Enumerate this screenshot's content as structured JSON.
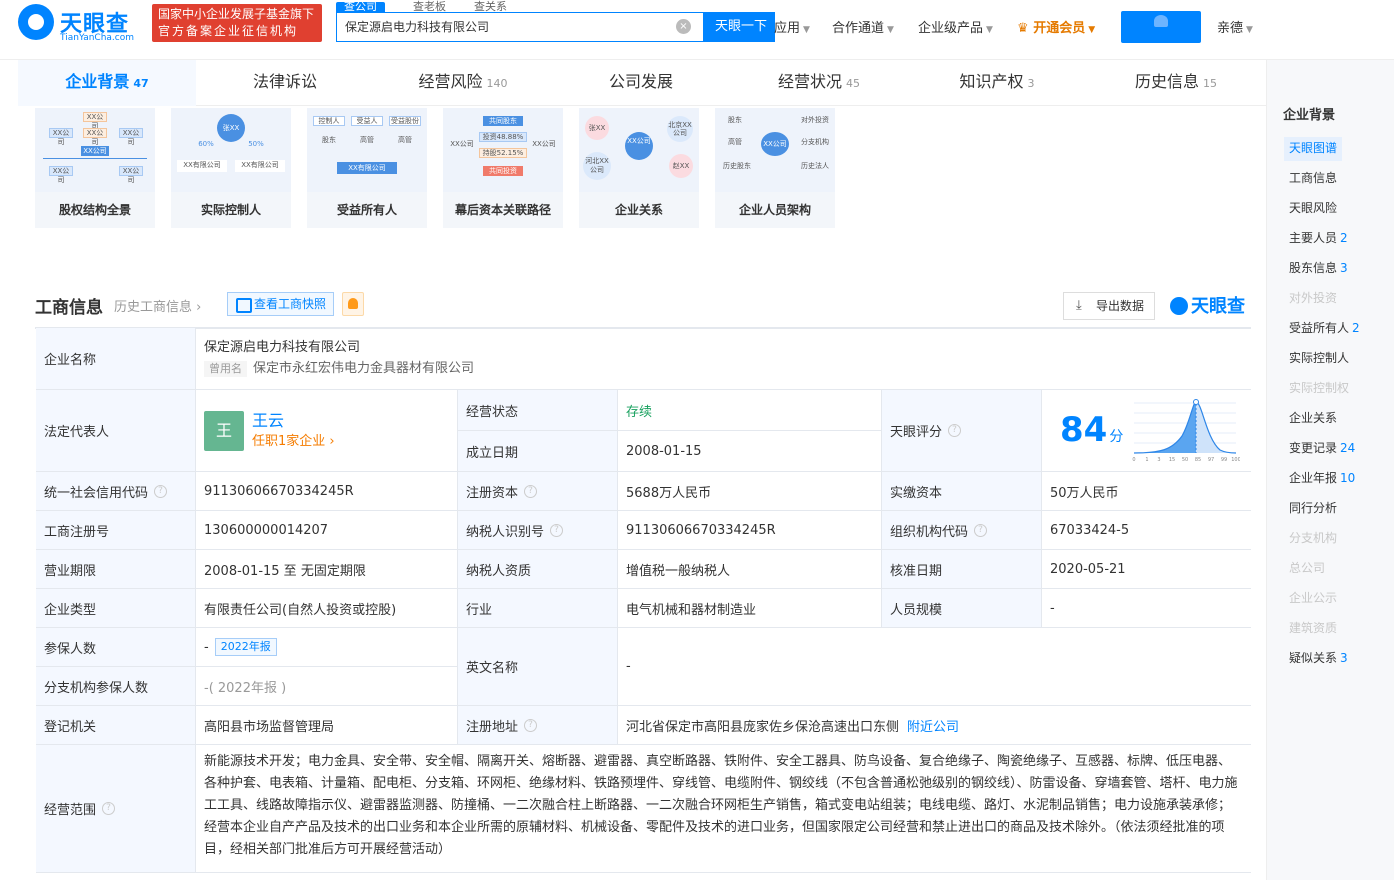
{
  "header": {
    "logo_text": "天眼查",
    "logo_sub": "TianYanCha.com",
    "gov_badge_line1": "国家中小企业发展子基金旗下",
    "gov_badge_line2": "官方备案企业征信机构",
    "search_tabs": [
      "查公司",
      "查老板",
      "查关系"
    ],
    "search_value": "保定源启电力科技有限公司",
    "search_button": "天眼一下",
    "nav_apps": "应用",
    "nav_channel": "合作通道",
    "nav_enterprise": "企业级产品",
    "nav_vip": "开通会员",
    "nav_user": "亲德"
  },
  "tabs": [
    {
      "label": "企业背景",
      "count": "47"
    },
    {
      "label": "法律诉讼",
      "count": ""
    },
    {
      "label": "经营风险",
      "count": "140"
    },
    {
      "label": "公司发展",
      "count": ""
    },
    {
      "label": "经营状况",
      "count": "45"
    },
    {
      "label": "知识产权",
      "count": "3"
    },
    {
      "label": "历史信息",
      "count": "15"
    }
  ],
  "cards": [
    {
      "title": "股权结构全景",
      "texts": [
        "XX公司",
        "XX公司",
        "XX公司",
        "XX公司",
        "XX公司",
        "XX公司",
        "XX公司"
      ]
    },
    {
      "title": "实际控制人",
      "texts": [
        "张XX",
        "XX有限公司",
        "XX有限公司",
        "60%",
        "50%"
      ]
    },
    {
      "title": "受益所有人",
      "texts": [
        "控制人",
        "受益人",
        "受益股份",
        "股东",
        "高管",
        "高管",
        "XX有限公司"
      ]
    },
    {
      "title": "幕后资本关联路径",
      "texts": [
        "共同股东",
        "XX公司",
        "XX公司",
        "投资48.88%",
        "持股52.15%",
        "共同投资"
      ]
    },
    {
      "title": "企业关系",
      "texts": [
        "张XX",
        "北京XX公司",
        "XX公司",
        "河北XX公司",
        "赵XX"
      ]
    },
    {
      "title": "企业人员架构",
      "texts": [
        "股东",
        "对外投资",
        "高管",
        "XX公司",
        "分支机构",
        "历史股东",
        "历史法人"
      ]
    }
  ],
  "section": {
    "title": "工商信息",
    "history_link": "历史工商信息",
    "snapshot_button": "查看工商快照",
    "export_button": "导出数据",
    "watermark": "天眼查"
  },
  "info": {
    "company_name_label": "企业名称",
    "company_name": "保定源启电力科技有限公司",
    "former_name_tag": "曾用名",
    "former_name": "保定市永红宏伟电力金具器材有限公司",
    "legal_rep_label": "法定代表人",
    "legal_rep_avatar": "王",
    "legal_rep_name": "王云",
    "legal_rep_sub": "任职1家企业",
    "status_label": "经营状态",
    "status": "存续",
    "founded_label": "成立日期",
    "founded": "2008-01-15",
    "score_label": "天眼评分",
    "score": "84",
    "score_unit": "分",
    "score_ticks": [
      "0",
      "1",
      "3",
      "15",
      "50",
      "85",
      "97",
      "99",
      "100"
    ],
    "credit_code_label": "统一社会信用代码",
    "credit_code": "91130606670334245R",
    "reg_capital_label": "注册资本",
    "reg_capital": "5688万人民币",
    "paid_capital_label": "实缴资本",
    "paid_capital": "50万人民币",
    "reg_no_label": "工商注册号",
    "reg_no": "130600000014207",
    "taxpayer_id_label": "纳税人识别号",
    "taxpayer_id": "91130606670334245R",
    "org_code_label": "组织机构代码",
    "org_code": "67033424-5",
    "term_label": "营业期限",
    "term": "2008-01-15 至 无固定期限",
    "taxpayer_type_label": "纳税人资质",
    "taxpayer_type": "增值税一般纳税人",
    "approval_label": "核准日期",
    "approval": "2020-05-21",
    "type_label": "企业类型",
    "type": "有限责任公司(自然人投资或控股)",
    "industry_label": "行业",
    "industry": "电气机械和器材制造业",
    "staff_label": "人员规模",
    "staff": "-",
    "insured_label": "参保人数",
    "insured": "-",
    "insured_badge": "2022年报",
    "english_label": "英文名称",
    "english": "-",
    "branch_insured_label": "分支机构参保人数",
    "branch_insured": "-( 2022年报 )",
    "authority_label": "登记机关",
    "authority": "高阳县市场监督管理局",
    "address_label": "注册地址",
    "address": "河北省保定市高阳县庞家佐乡保沧高速出口东侧",
    "nearby_link": "附近公司",
    "scope_label": "经营范围",
    "scope": "新能源技术开发；电力金具、安全带、安全帽、隔离开关、熔断器、避雷器、真空断路器、铁附件、安全工器具、防鸟设备、复合绝缘子、陶瓷绝缘子、互感器、标牌、低压电器、各种护套、电表箱、计量箱、配电柜、分支箱、环网柜、绝缘材料、铁路预埋件、穿线管、电缆附件、钢绞线（不包含普通松弛级别的钢绞线）、防雷设备、穿墙套管、塔杆、电力施工工具、线路故障指示仪、避雷器监测器、防撞桶、一二次融合柱上断路器、一二次融合环网柜生产销售，箱式变电站组装；电线电缆、路灯、水泥制品销售；电力设施承装承修；经营本企业自产产品及技术的出口业务和本企业所需的原辅材料、机械设备、零配件及技术的进口业务，但国家限定公司经营和禁止进出口的商品及技术除外。（依法须经批准的项目，经相关部门批准后方可开展经营活动）"
  },
  "sidebar": {
    "title": "企业背景",
    "items": [
      {
        "label": "天眼图谱",
        "count": ""
      },
      {
        "label": "工商信息",
        "count": ""
      },
      {
        "label": "天眼风险",
        "count": ""
      },
      {
        "label": "主要人员",
        "count": "2"
      },
      {
        "label": "股东信息",
        "count": "3"
      },
      {
        "label": "对外投资",
        "count": ""
      },
      {
        "label": "受益所有人",
        "count": "2"
      },
      {
        "label": "实际控制人",
        "count": ""
      },
      {
        "label": "实际控制权",
        "count": ""
      },
      {
        "label": "企业关系",
        "count": ""
      },
      {
        "label": "变更记录",
        "count": "24"
      },
      {
        "label": "企业年报",
        "count": "10"
      },
      {
        "label": "同行分析",
        "count": ""
      },
      {
        "label": "分支机构",
        "count": ""
      },
      {
        "label": "总公司",
        "count": ""
      },
      {
        "label": "企业公示",
        "count": ""
      },
      {
        "label": "建筑资质",
        "count": ""
      },
      {
        "label": "疑似关系",
        "count": "3"
      }
    ]
  },
  "colors": {
    "brand": "#0084ff",
    "alive": "#19a15f",
    "accent": "#f57c00",
    "badge": "#e04030"
  }
}
